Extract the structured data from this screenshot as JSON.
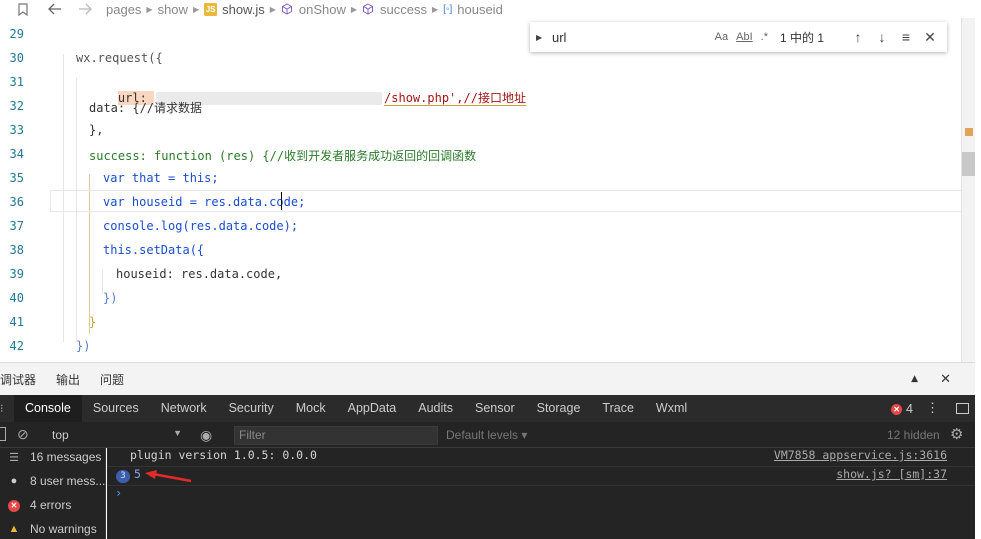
{
  "breadcrumb": {
    "items": [
      "pages",
      "show",
      "show.js",
      "onShow",
      "success",
      "houseid"
    ]
  },
  "editor": {
    "lines": [
      {
        "n": "29",
        "text": ""
      },
      {
        "n": "30",
        "text": "wx.request({"
      },
      {
        "n": "31",
        "pre": "url: ",
        "post": "/show.php',//接口地址"
      },
      {
        "n": "32",
        "text": "data: {//请求数据"
      },
      {
        "n": "33",
        "text": "},"
      },
      {
        "n": "34",
        "text": "success: function (res) {//收到开发者服务成功返回的回调函数"
      },
      {
        "n": "35",
        "text": "var that = this;"
      },
      {
        "n": "36",
        "text": "var houseid = res.data.code;"
      },
      {
        "n": "37",
        "text": "console.log(res.data.code);"
      },
      {
        "n": "38",
        "text": "this.setData({"
      },
      {
        "n": "39",
        "text": "houseid: res.data.code,"
      },
      {
        "n": "40",
        "text": "})"
      },
      {
        "n": "41",
        "text": "}"
      },
      {
        "n": "42",
        "text": "})"
      }
    ]
  },
  "find": {
    "query": "url",
    "opt_case": "Aa",
    "opt_word": "AbI",
    "opt_regex": ".*",
    "count": "1 中的 1"
  },
  "panel": {
    "tabs": [
      "调试器",
      "输出",
      "问题"
    ]
  },
  "devtools": {
    "tabs": [
      "Console",
      "Sources",
      "Network",
      "Security",
      "Mock",
      "AppData",
      "Audits",
      "Sensor",
      "Storage",
      "Trace",
      "Wxml"
    ],
    "active_tab": "Console",
    "error_count": "4"
  },
  "console_bar": {
    "context": "top",
    "filter_placeholder": "Filter",
    "levels": "Default levels ▾",
    "hidden": "12 hidden"
  },
  "console_sidebar": {
    "items": [
      {
        "label": "16 messages",
        "icon": "list-icon"
      },
      {
        "label": "8 user mess...",
        "icon": "user-icon"
      },
      {
        "label": "4 errors",
        "icon": "error-icon"
      },
      {
        "label": "No warnings",
        "icon": "warning-icon"
      }
    ]
  },
  "console_rows": [
    {
      "message": "plugin version 1.0.5:  0.0.0",
      "source": "VM7858 appservice.js:3616"
    },
    {
      "repeat": "3",
      "message": "5",
      "source": "show.js? [sm]:37"
    }
  ],
  "colors": {
    "accent_error": "#e54848",
    "accent_blue": "#3b5fae"
  }
}
